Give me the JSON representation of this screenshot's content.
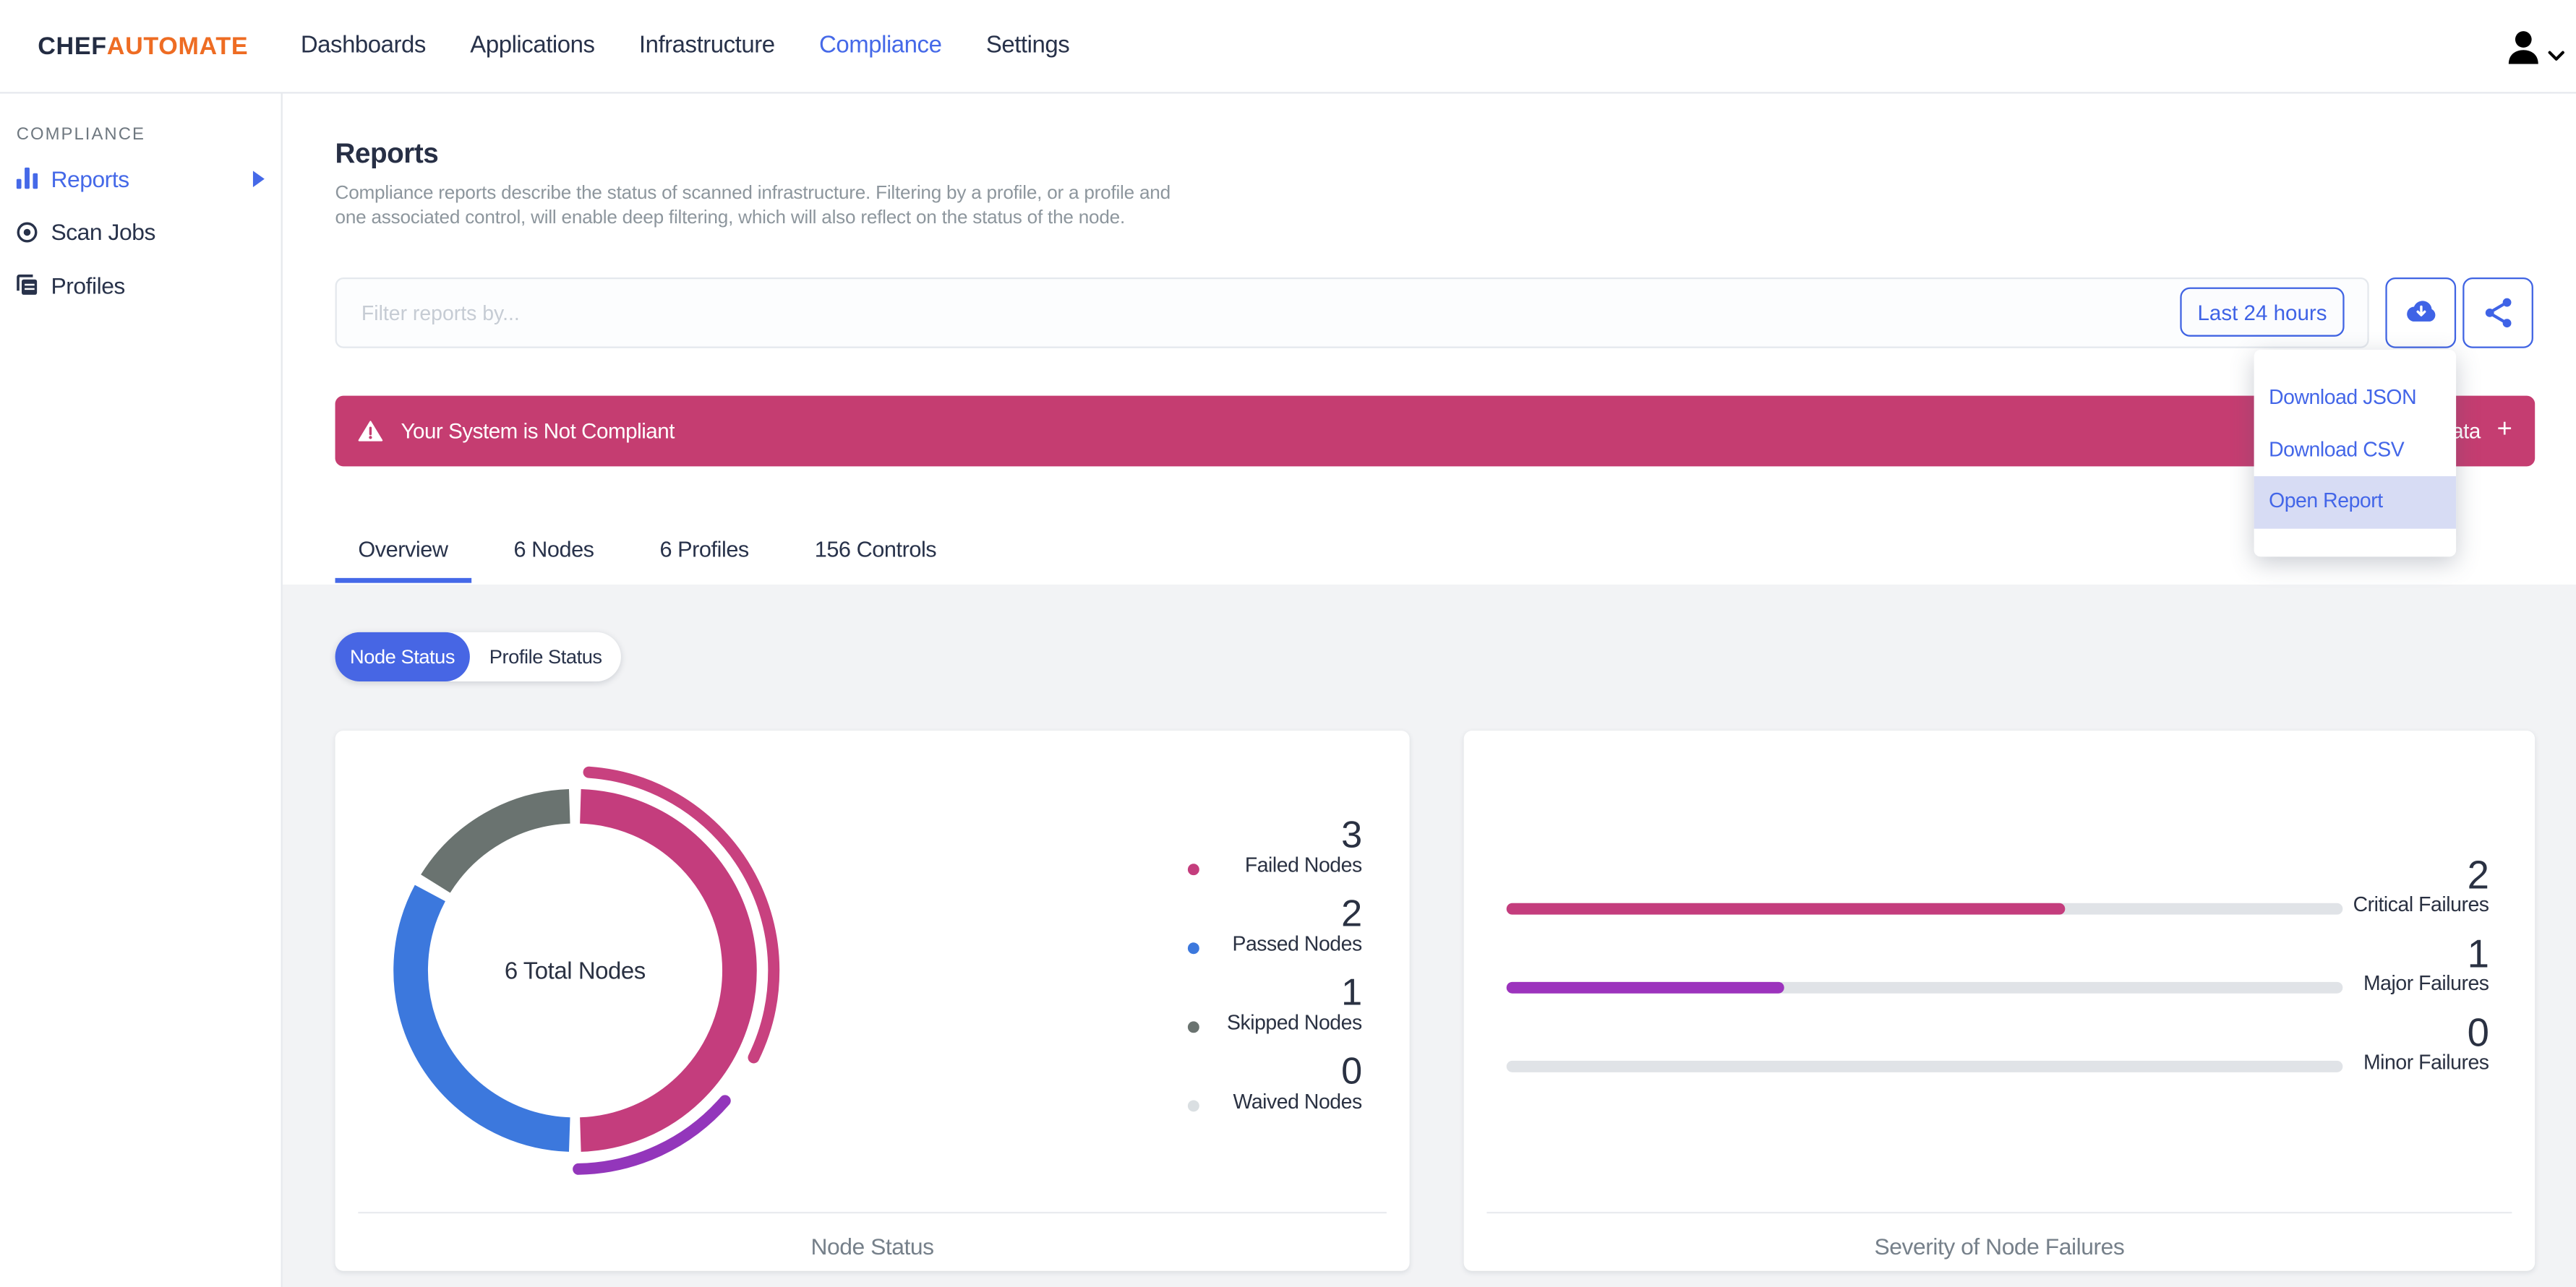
{
  "nav": {
    "brand": {
      "chef": "CHEF",
      "automate": "AUTOMATE"
    },
    "items": [
      "Dashboards",
      "Applications",
      "Infrastructure",
      "Compliance",
      "Settings"
    ],
    "active_item": "Compliance"
  },
  "sidebar": {
    "section_label": "COMPLIANCE",
    "items": [
      {
        "label": "Reports",
        "active": true
      },
      {
        "label": "Scan Jobs",
        "active": false
      },
      {
        "label": "Profiles",
        "active": false
      }
    ]
  },
  "page": {
    "title": "Reports",
    "description": "Compliance reports describe the status of scanned infrastructure. Filtering by a profile, or a profile and\none associated control, will enable deep filtering, which will also reflect on the status of the node."
  },
  "filter": {
    "placeholder": "Filter reports by...",
    "time_range_label": "Last 24 hours"
  },
  "banner": {
    "message": "Your System is Not Compliant",
    "metadata_label": "Report Metadata",
    "expand_symbol": "+"
  },
  "download_menu": {
    "items": [
      "Download JSON",
      "Download CSV",
      "Open Report"
    ],
    "highlighted": "Open Report"
  },
  "tabs": [
    {
      "label": "Overview",
      "active": true
    },
    {
      "label": "6 Nodes",
      "active": false
    },
    {
      "label": "6 Profiles",
      "active": false
    },
    {
      "label": "156 Controls",
      "active": false
    }
  ],
  "status_toggle": {
    "options": [
      "Node Status",
      "Profile Status"
    ],
    "selected": "Node Status"
  },
  "colors": {
    "accent_blue": "#4569e8",
    "brand_orange": "#ee6c23",
    "banner_pink": "#c53d71",
    "dark_navy": "#28324a"
  },
  "chart_data": [
    {
      "type": "donut",
      "title": "Node Status",
      "center_label": "6 Total Nodes",
      "total_nodes": 6,
      "segments": [
        {
          "label": "Failed Nodes",
          "value": 3,
          "color": "#c43d7d"
        },
        {
          "label": "Passed Nodes",
          "value": 2,
          "color": "#3c78dd"
        },
        {
          "label": "Skipped Nodes",
          "value": 1,
          "color": "#6a7370"
        },
        {
          "label": "Waived Nodes",
          "value": 0,
          "color": "#dadfe2"
        }
      ],
      "outer_arcs": [
        {
          "label": "Critical",
          "value": 2,
          "color": "#c8417f"
        },
        {
          "label": "Major",
          "value": 1,
          "color": "#9336bb"
        }
      ]
    },
    {
      "type": "bar",
      "title": "Severity of Node Failures",
      "bars": [
        {
          "label": "Critical Failures",
          "value": 2,
          "color": "#c43d7d"
        },
        {
          "label": "Major Failures",
          "value": 1,
          "color": "#9c33bd"
        },
        {
          "label": "Minor Failures",
          "value": 0,
          "color": "#e0e3e7"
        }
      ],
      "track_color": "#e0e3e7"
    }
  ]
}
